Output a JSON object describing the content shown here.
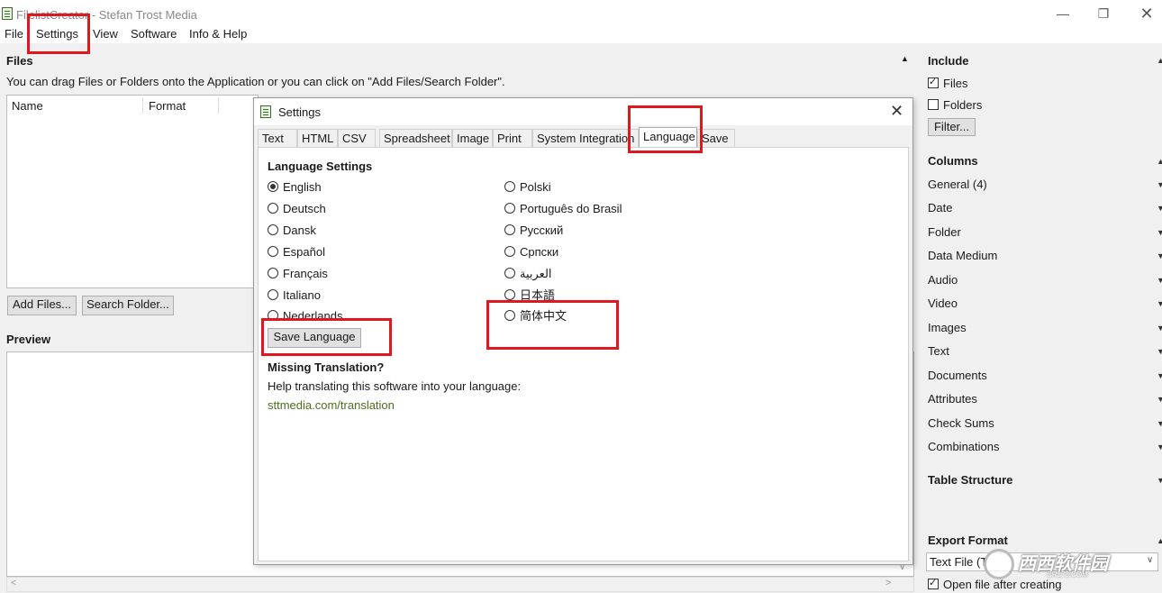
{
  "window": {
    "title": "FilelistCreator - Stefan Trost Media",
    "minimize_icon": "minimize-icon",
    "maximize_icon": "restore-icon",
    "close_icon": "close-icon"
  },
  "menu": [
    "File",
    "Settings",
    "View",
    "Software",
    "Info & Help"
  ],
  "files": {
    "title": "Files",
    "hint": "You can drag Files or Folders onto the Application or you can click on \"Add Files/Search Folder\".",
    "columns": [
      "Name",
      "Format"
    ],
    "add_files": "Add Files...",
    "search_folder": "Search Folder..."
  },
  "preview": {
    "title": "Preview"
  },
  "dialog": {
    "title": "Settings",
    "tabs": [
      "Text",
      "HTML",
      "CSV",
      "Spreadsheet",
      "Image",
      "Print",
      "System Integration",
      "Language",
      "Save"
    ],
    "active_tab": "Language",
    "language_settings_title": "Language Settings",
    "languages_left": [
      "English",
      "Deutsch",
      "Dansk",
      "Español",
      "Français",
      "Italiano",
      "Nederlands"
    ],
    "languages_right": [
      "Polski",
      "Português do Brasil",
      "Русский",
      "Српски",
      "العربية",
      "日本語",
      "简体中文"
    ],
    "selected_language": "English",
    "save_language": "Save Language",
    "missing_title": "Missing Translation?",
    "missing_text": "Help translating this software into your language:",
    "link": "sttmedia.com/translation"
  },
  "right_panel": {
    "include_title": "Include",
    "files_label": "Files",
    "files_checked": true,
    "folders_label": "Folders",
    "folders_checked": false,
    "filter_button": "Filter...",
    "columns_title": "Columns",
    "column_groups": [
      "General (4)",
      "Date",
      "Folder",
      "Data Medium",
      "Audio",
      "Video",
      "Images",
      "Text",
      "Documents",
      "Attributes",
      "Check Sums",
      "Combinations"
    ],
    "table_structure_title": "Table Structure",
    "export_format_title": "Export Format",
    "export_format_value": "Text File (T",
    "open_after_label": "Open file after creating",
    "open_after_checked": true
  },
  "watermark": {
    "text": "西西软件园",
    "sub": "CR173.COM"
  },
  "colors": {
    "highlight": "#e0171f",
    "link": "#4a6f1e"
  }
}
